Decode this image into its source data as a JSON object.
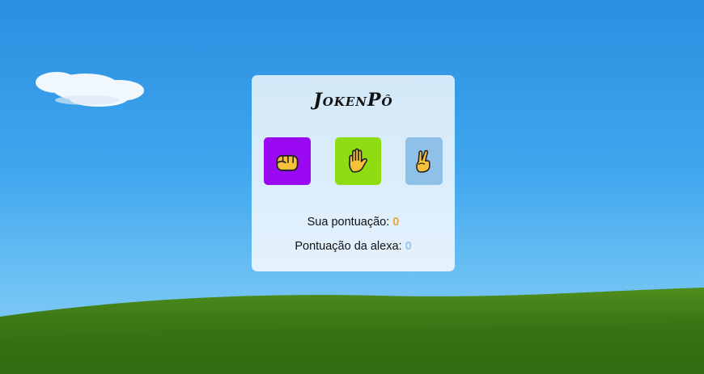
{
  "game": {
    "title": "JokenPô",
    "choices": [
      {
        "name": "rock",
        "icon": "fist-icon",
        "color": "#9b09f2"
      },
      {
        "name": "paper",
        "icon": "raised-hand-icon",
        "color": "#8fdc12"
      },
      {
        "name": "scissors",
        "icon": "victory-hand-icon",
        "color": "#8fc0e8"
      }
    ],
    "user_score_label": "Sua pontuação:",
    "user_score": "0",
    "ai_score_label": "Pontuação da alexa:",
    "ai_score": "0"
  },
  "colors": {
    "user_score": "#f0a53a",
    "ai_score": "#9ec0ea",
    "card_bg": "#dbedfb"
  }
}
